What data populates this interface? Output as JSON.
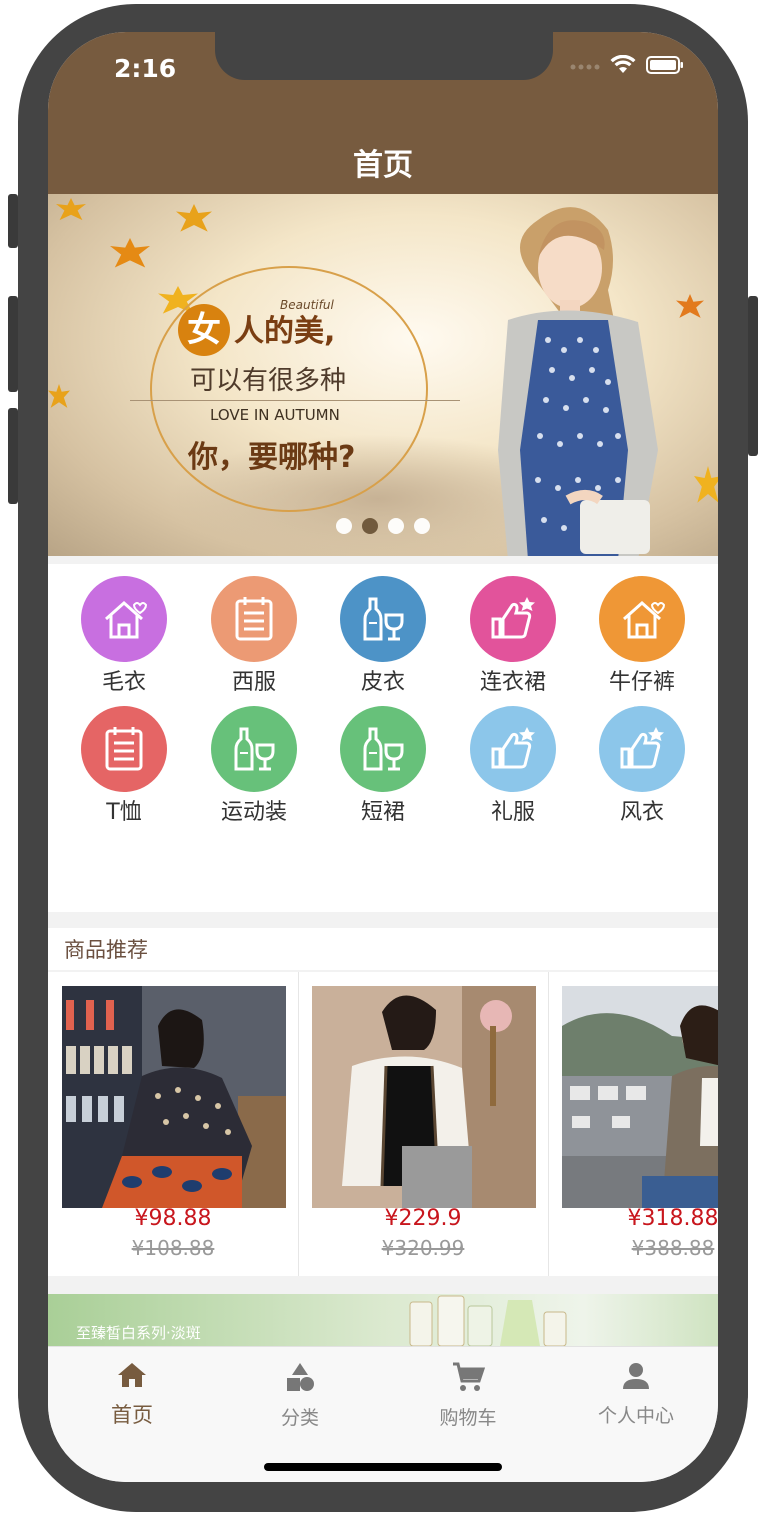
{
  "status_bar": {
    "time": "2:16"
  },
  "nav": {
    "title": "首页"
  },
  "banner": {
    "beautiful": "Beautiful",
    "line1_char": "女",
    "line1_rest": "人的美,",
    "line2": "可以有很多种",
    "line3": "LOVE IN AUTUMN",
    "line4": "你，要哪种?",
    "dots": 4,
    "active_dot": 1
  },
  "categories": [
    {
      "label": "毛衣",
      "icon": "house-heart-icon",
      "color": "#c86fe0"
    },
    {
      "label": "西服",
      "icon": "notepad-icon",
      "color": "#ec9a74"
    },
    {
      "label": "皮衣",
      "icon": "wine-bottle-glass-icon",
      "color": "#4d93c7"
    },
    {
      "label": "连衣裙",
      "icon": "thumbs-up-star-icon",
      "color": "#e2539b"
    },
    {
      "label": "牛仔裤",
      "icon": "house-heart-icon",
      "color": "#ef9736"
    },
    {
      "label": "T恤",
      "icon": "notepad-icon",
      "color": "#e56565"
    },
    {
      "label": "运动装",
      "icon": "wine-bottle-glass-icon",
      "color": "#67c17a"
    },
    {
      "label": "短裙",
      "icon": "wine-bottle-glass-icon",
      "color": "#67c17a"
    },
    {
      "label": "礼服",
      "icon": "thumbs-up-star-icon",
      "color": "#8cc6ea"
    },
    {
      "label": "风衣",
      "icon": "thumbs-up-star-icon",
      "color": "#8cc6ea"
    }
  ],
  "section": {
    "title": "商品推荐"
  },
  "products": [
    {
      "price": "¥98.88",
      "old_price": "¥108.88"
    },
    {
      "price": "¥229.9",
      "old_price": "¥320.99"
    },
    {
      "price": "¥318.88",
      "old_price": "¥388.88"
    }
  ],
  "promo": {
    "text": "至臻皙白系列·淡斑"
  },
  "tabs": [
    {
      "label": "首页",
      "icon": "home-icon",
      "active": true
    },
    {
      "label": "分类",
      "icon": "shapes-icon",
      "active": false
    },
    {
      "label": "购物车",
      "icon": "cart-icon",
      "active": false
    },
    {
      "label": "个人中心",
      "icon": "person-icon",
      "active": false
    }
  ],
  "colors": {
    "brand": "#775b3f",
    "price": "#c8161d",
    "old_price": "#999999"
  }
}
